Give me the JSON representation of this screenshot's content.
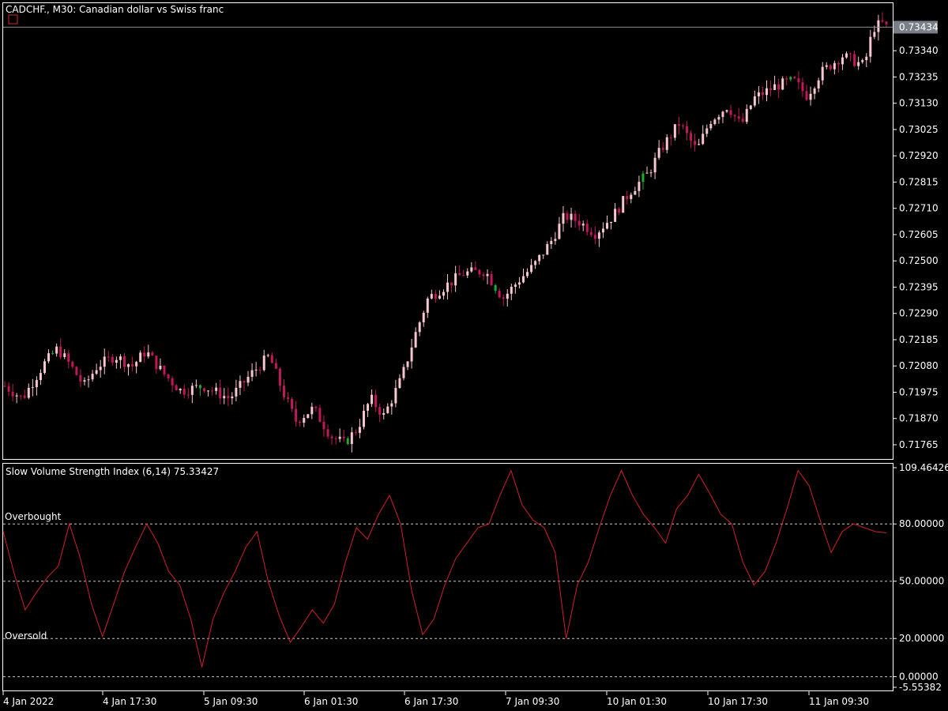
{
  "main_chart": {
    "title": "CADCHF., M30:  Canadian dollar vs Swiss franc",
    "current_price_label": "0.73434"
  },
  "indicator": {
    "title": "Slow Volume Strength Index (6,14) 75.33427",
    "overbought_label": "Overbought",
    "oversold_label": "Oversold"
  },
  "colors": {
    "background": "#000000",
    "frame": "#ffffff",
    "bull_candle": "#f7c6cf",
    "bear_candle": "#c2185b",
    "green_candle": "#1faa2b",
    "indicator_line": "#d01e2e",
    "level_line": "#c8c8c8",
    "price_line": "#8c8c8c"
  },
  "chart_data": [
    {
      "type": "candlestick",
      "title": "CADCHF., M30:  Canadian dollar vs Swiss franc",
      "symbol": "CADCHF.",
      "timeframe": "M30",
      "y_ticks": [
        "0.73434",
        "0.73340",
        "0.73235",
        "0.73130",
        "0.73025",
        "0.72920",
        "0.72815",
        "0.72710",
        "0.72605",
        "0.72500",
        "0.72395",
        "0.72290",
        "0.72185",
        "0.72080",
        "0.71975",
        "0.71870",
        "0.71765"
      ],
      "ylim": [
        0.71705,
        0.7353
      ],
      "current_price": 0.73434,
      "close_path": [
        [
          0,
          0.72
        ],
        [
          0.02,
          0.7195
        ],
        [
          0.045,
          0.7209
        ],
        [
          0.06,
          0.7215
        ],
        [
          0.075,
          0.7208
        ],
        [
          0.09,
          0.72
        ],
        [
          0.105,
          0.7208
        ],
        [
          0.125,
          0.7212
        ],
        [
          0.145,
          0.7208
        ],
        [
          0.16,
          0.7214
        ],
        [
          0.18,
          0.7205
        ],
        [
          0.2,
          0.7198
        ],
        [
          0.225,
          0.72
        ],
        [
          0.255,
          0.7195
        ],
        [
          0.28,
          0.7205
        ],
        [
          0.3,
          0.7212
        ],
        [
          0.315,
          0.7198
        ],
        [
          0.33,
          0.7186
        ],
        [
          0.35,
          0.7191
        ],
        [
          0.37,
          0.718
        ],
        [
          0.385,
          0.7177
        ],
        [
          0.4,
          0.7183
        ],
        [
          0.415,
          0.7195
        ],
        [
          0.43,
          0.7188
        ],
        [
          0.45,
          0.7203
        ],
        [
          0.465,
          0.722
        ],
        [
          0.48,
          0.7235
        ],
        [
          0.5,
          0.724
        ],
        [
          0.52,
          0.7245
        ],
        [
          0.545,
          0.7246
        ],
        [
          0.565,
          0.7235
        ],
        [
          0.585,
          0.7243
        ],
        [
          0.6,
          0.7248
        ],
        [
          0.62,
          0.7258
        ],
        [
          0.635,
          0.7268
        ],
        [
          0.65,
          0.7266
        ],
        [
          0.67,
          0.7261
        ],
        [
          0.69,
          0.7268
        ],
        [
          0.71,
          0.7278
        ],
        [
          0.73,
          0.7285
        ],
        [
          0.745,
          0.7295
        ],
        [
          0.765,
          0.7305
        ],
        [
          0.785,
          0.7294
        ],
        [
          0.8,
          0.7306
        ],
        [
          0.82,
          0.7312
        ],
        [
          0.835,
          0.7304
        ],
        [
          0.85,
          0.7315
        ],
        [
          0.875,
          0.732
        ],
        [
          0.895,
          0.7322
        ],
        [
          0.91,
          0.7316
        ],
        [
          0.925,
          0.7325
        ],
        [
          0.95,
          0.7332
        ],
        [
          0.975,
          0.7328
        ],
        [
          0.985,
          0.7343
        ],
        [
          0.995,
          0.7345
        ],
        [
          1.0,
          0.73434
        ]
      ]
    },
    {
      "type": "line",
      "title": "Slow Volume Strength Index (6,14) 75.33427",
      "y_ticks": [
        "109.46426",
        "80.00000",
        "50.00000",
        "20.00000",
        "0.00000",
        "-5.55382"
      ],
      "ylim": [
        -5.55382,
        109.46426
      ],
      "levels": [
        80,
        50,
        20,
        0
      ],
      "current_value": 75.33427,
      "series": [
        {
          "values": [
            76,
            54,
            35,
            44,
            52,
            58,
            80,
            62,
            38,
            21,
            38,
            55,
            68,
            80,
            70,
            55,
            48,
            30,
            5,
            30,
            44,
            55,
            68,
            76,
            50,
            32,
            18,
            26,
            35,
            28,
            38,
            60,
            78,
            72,
            85,
            95,
            80,
            45,
            22,
            30,
            48,
            62,
            70,
            78,
            80,
            95,
            108,
            90,
            82,
            78,
            65,
            20,
            48,
            60,
            78,
            95,
            108,
            95,
            85,
            78,
            70,
            88,
            95,
            106,
            96,
            85,
            80,
            60,
            48,
            55,
            70,
            88,
            108,
            100,
            82,
            65,
            76,
            80,
            78,
            76,
            75.33427
          ]
        }
      ]
    }
  ],
  "x_axis": {
    "labels": [
      "4 Jan 2022",
      "4 Jan 17:30",
      "5 Jan 09:30",
      "6 Jan 01:30",
      "6 Jan 17:30",
      "7 Jan 09:30",
      "10 Jan 01:30",
      "10 Jan 17:30",
      "11 Jan 09:30"
    ]
  }
}
